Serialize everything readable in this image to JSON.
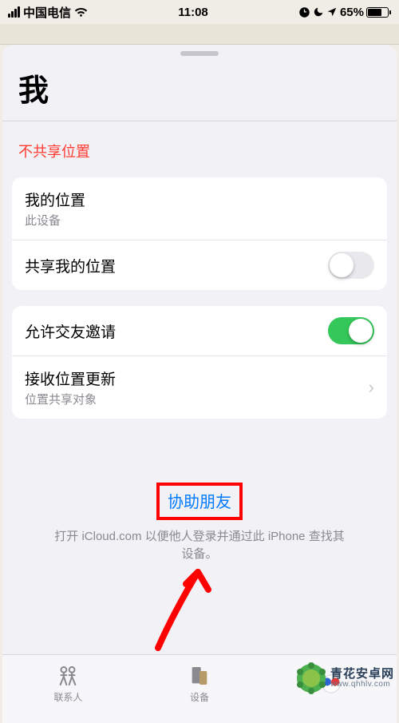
{
  "status": {
    "carrier": "中国电信",
    "time": "11:08",
    "battery_pct": "65%"
  },
  "sheet": {
    "title": "我",
    "not_sharing": "不共享位置"
  },
  "group1": {
    "my_location": {
      "label": "我的位置",
      "sub": "此设备"
    },
    "share_location": {
      "label": "共享我的位置"
    }
  },
  "group2": {
    "allow_friend": {
      "label": "允许交友邀请"
    },
    "receive_update": {
      "label": "接收位置更新",
      "sub": "位置共享对象"
    }
  },
  "assist": {
    "link": "协助朋友",
    "hint_a": "打开 iCloud.com 以便他人登录并通过此 iPhone 查找其",
    "hint_b": "设备。"
  },
  "tabs": {
    "people": "联系人",
    "devices": "设备"
  },
  "watermark": {
    "cn": "青花安卓网",
    "url": "www.qhhlv.com"
  }
}
